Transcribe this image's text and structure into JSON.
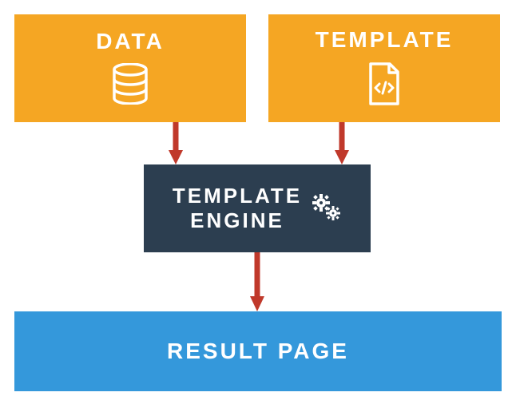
{
  "diagram": {
    "nodes": {
      "data": {
        "label": "DATA",
        "color": "#f5a623",
        "icon": "database-icon"
      },
      "template": {
        "label": "TEMPLATE",
        "color": "#f5a623",
        "icon": "file-code-icon"
      },
      "engine": {
        "label_line1": "TEMPLATE",
        "label_line2": "ENGINE",
        "color": "#2c3e50",
        "icon": "gears-icon"
      },
      "result": {
        "label": "RESULT PAGE",
        "color": "#3498db"
      }
    },
    "arrows": {
      "color": "#c0392b",
      "edges": [
        {
          "from": "data",
          "to": "engine"
        },
        {
          "from": "template",
          "to": "engine"
        },
        {
          "from": "engine",
          "to": "result"
        }
      ]
    }
  }
}
